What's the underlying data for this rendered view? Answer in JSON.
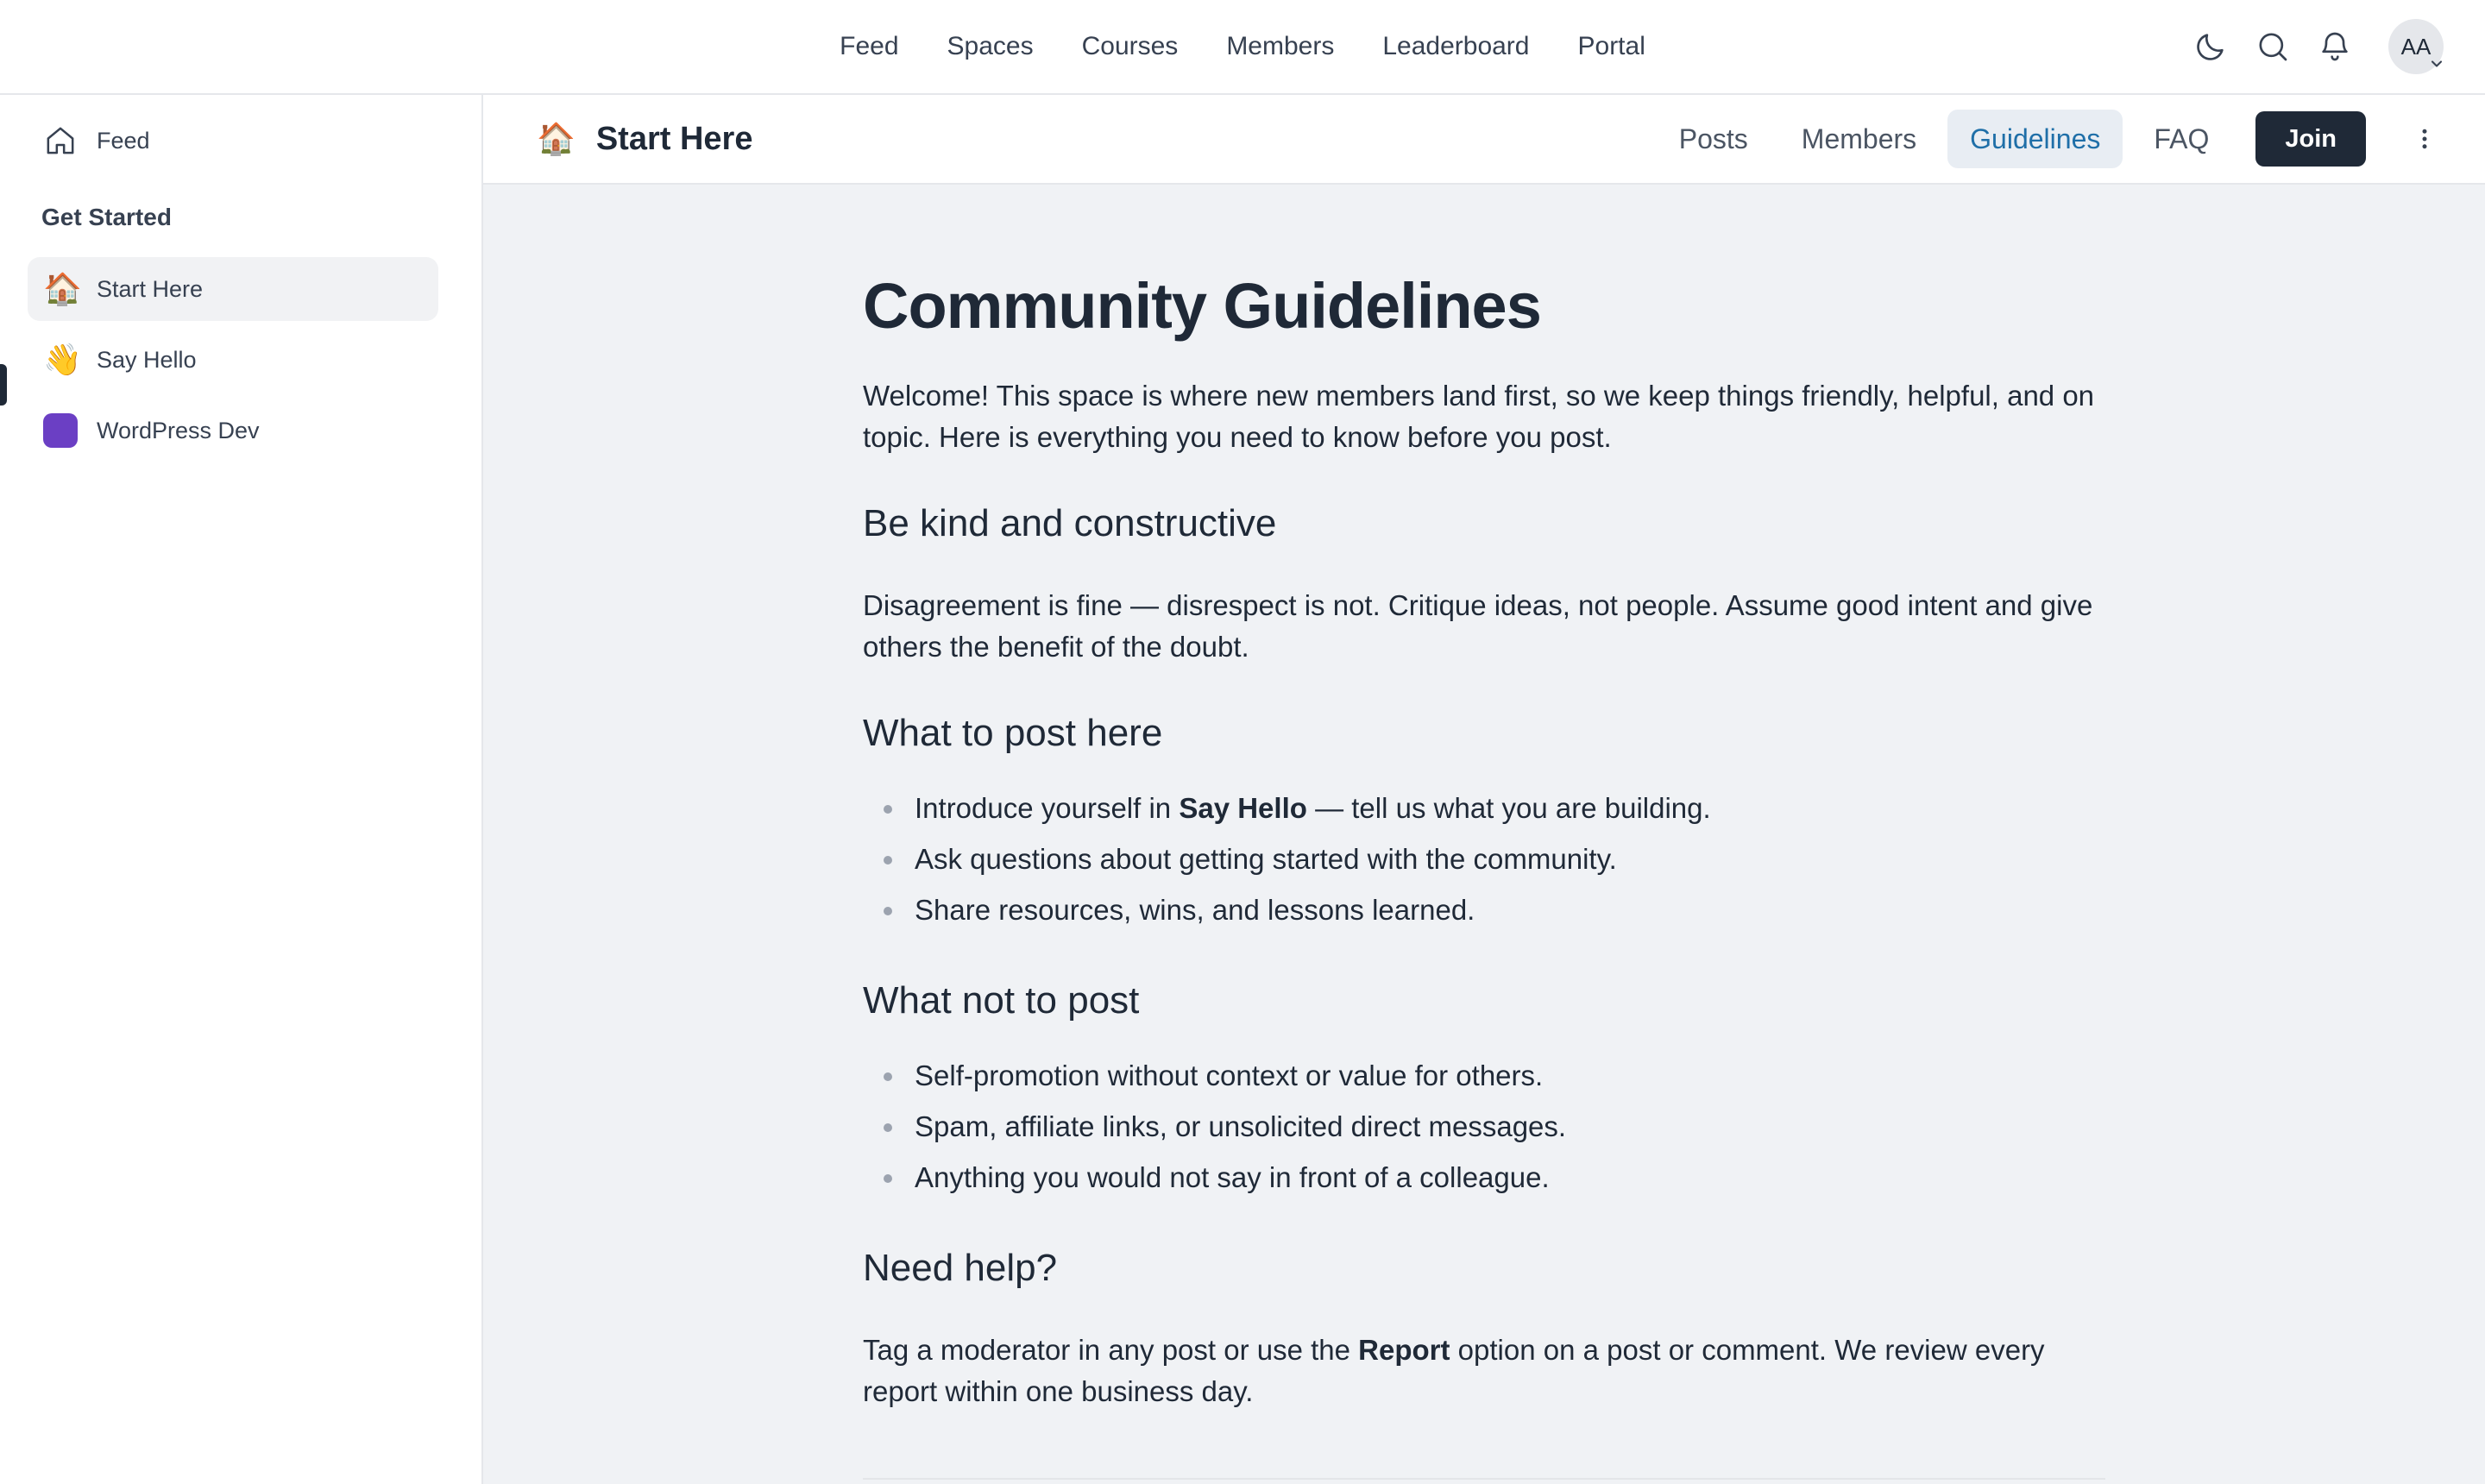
{
  "topnav": {
    "items": [
      "Feed",
      "Spaces",
      "Courses",
      "Members",
      "Leaderboard",
      "Portal"
    ],
    "avatar_initials": "AA"
  },
  "icons": {
    "theme": "moon-icon",
    "search": "search-icon",
    "notifications": "bell-icon",
    "more": "kebab-menu-icon"
  },
  "sidebar": {
    "feed_label": "Feed",
    "heading": "Get Started",
    "items": [
      {
        "label": "Start Here",
        "emoji": "🏠",
        "active": true
      },
      {
        "label": "Say Hello",
        "emoji": "👋",
        "active": false
      },
      {
        "label": "WordPress Dev",
        "emoji": "",
        "color": "#6b3fc4",
        "active": false
      }
    ]
  },
  "space": {
    "emoji": "🏠",
    "title": "Start Here",
    "tabs": [
      "Posts",
      "Members",
      "Guidelines",
      "FAQ"
    ],
    "active_tab": "Guidelines",
    "join_label": "Join"
  },
  "article": {
    "title": "Community Guidelines",
    "intro": "Welcome! This space is where new members land first, so we keep things friendly, helpful, and on topic. Here is everything you need to know before you post.",
    "s1_heading": "Be kind and constructive",
    "s1_text": "Disagreement is fine — disrespect is not. Critique ideas, not people. Assume good intent and give others the benefit of the doubt.",
    "s2_heading": "What to post here",
    "s2_item1_pre": "Introduce yourself in ",
    "s2_item1_bold": "Say Hello",
    "s2_item1_post": " — tell us what you are building.",
    "s2_item2": "Ask questions about getting started with the community.",
    "s2_item3": "Share resources, wins, and lessons learned.",
    "s3_heading": "What not to post",
    "s3_items": [
      "Self-promotion without context or value for others.",
      "Spam, affiliate links, or unsolicited direct messages.",
      "Anything you would not say in front of a colleague."
    ],
    "s4_heading": "Need help?",
    "s4_pre": "Tag a moderator in any post or use the ",
    "s4_bold": "Report",
    "s4_post": " option on a post or comment. We review every report within one business day."
  },
  "colors": {
    "accent": "#1f6fa8",
    "join_bg": "#1f2937",
    "content_bg": "#f0f2f5"
  }
}
